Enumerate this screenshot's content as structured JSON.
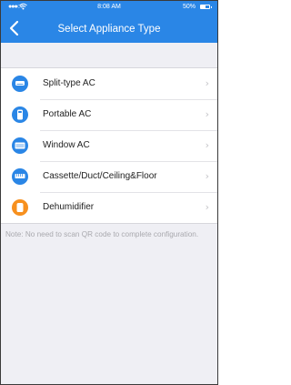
{
  "status_bar": {
    "signal": "●●●○○",
    "time": "8:08 AM",
    "battery": "50%",
    "battery_level": 0.5
  },
  "header": {
    "title": "Select Appliance Type",
    "back_icon": "chevron-left-icon"
  },
  "appliances": [
    {
      "label": "Split-type AC",
      "icon": "split-ac-icon",
      "color": "#2a86e6"
    },
    {
      "label": "Portable AC",
      "icon": "portable-ac-icon",
      "color": "#2a86e6"
    },
    {
      "label": "Window AC",
      "icon": "window-ac-icon",
      "color": "#2a86e6"
    },
    {
      "label": "Cassette/Duct/Ceiling&Floor",
      "icon": "cassette-ac-icon",
      "color": "#2a86e6"
    },
    {
      "label": "Dehumidifier",
      "icon": "dehumidifier-icon",
      "color": "#f7901e"
    }
  ],
  "note": "Note: No need to scan QR code to complete configuration.",
  "colors": {
    "header": "#2a86e6",
    "background": "#efeff4",
    "accent_orange": "#f7901e"
  }
}
